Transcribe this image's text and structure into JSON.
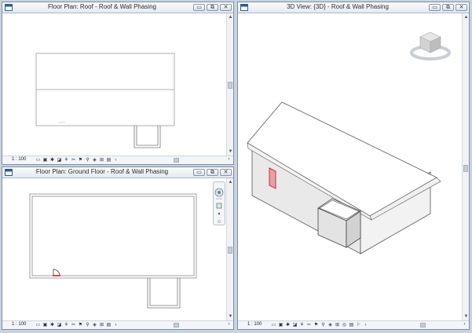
{
  "views": {
    "roof_plan": {
      "title": "Floor Plan: Roof - Roof & Wall Phasing",
      "scale": "1 : 100"
    },
    "ground_plan": {
      "title": "Floor Plan: Ground Floor - Roof & Wall Phasing",
      "scale": "1 : 100"
    },
    "view3d": {
      "title": "3D View: {3D} - Roof & Wall Phasing",
      "scale": "1 : 100"
    }
  },
  "window_buttons": {
    "minimize": "▭",
    "restore": "⧉",
    "close": "✕"
  },
  "view_controls": {
    "plan": [
      "▭",
      "▣",
      "✱",
      "◪",
      "⚘",
      "✂",
      "⚑",
      "⚲",
      "◈",
      "⊞",
      "▤",
      "‹"
    ],
    "three_d": [
      "▭",
      "▣",
      "✱",
      "◪",
      "⚘",
      "✂",
      "⚑",
      "⚲",
      "◈",
      "⊞",
      "◎",
      "▤",
      "⚐",
      "‹"
    ]
  },
  "nav_bar_icons": [
    "steering-wheel-icon",
    "zoom-icon"
  ],
  "colors": {
    "frame": "#7d8ea3",
    "door": "#e8a0a8",
    "door_outline": "#c0303a",
    "wall_side": "#e9e9e9",
    "wall_end": "#f2f2f2"
  }
}
